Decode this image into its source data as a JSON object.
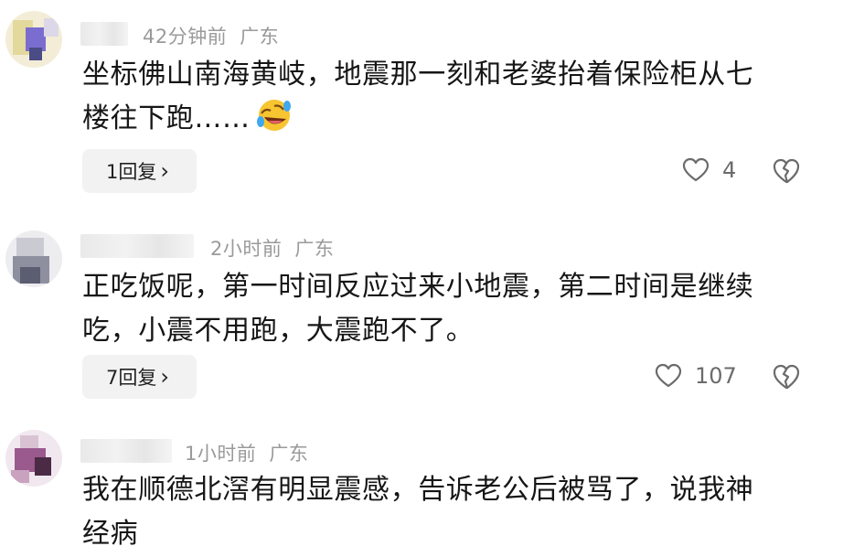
{
  "comments": [
    {
      "time": "42分钟前",
      "location": "广东",
      "text_line1": "坐标佛山南海黄岐，地震那一刻和老婆抬着保险柜从七",
      "text_line2": "楼往下跑……",
      "emoji": "rolling-laughing-emoji",
      "replies_label": "1回复",
      "likes": "4"
    },
    {
      "time": "2小时前",
      "location": "广东",
      "text_line1": "正吃饭呢，第一时间反应过来小地震，第二时间是继续",
      "text_line2": "吃，小震不用跑，大震跑不了。",
      "replies_label": "7回复",
      "likes": "107"
    },
    {
      "time": "1小时前",
      "location": "广东",
      "text_line1": "我在顺德北滘有明显震感，告诉老公后被骂了，说我神",
      "text_line2": "经病"
    }
  ],
  "icons": {
    "reply_chevron": "chevron-right-icon",
    "like": "heart-outline-icon",
    "dislike": "broken-heart-icon"
  },
  "colors": {
    "meta_text": "#9a9a9a",
    "button_bg": "#f2f2f2",
    "body_text": "#161616"
  }
}
